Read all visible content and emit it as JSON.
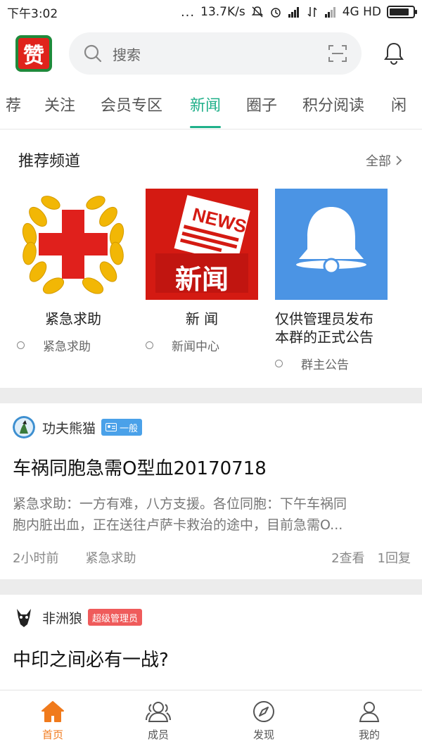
{
  "status_bar": {
    "time": "下午3:02",
    "dots": "...",
    "net_speed": "13.7K/s",
    "network": "4G HD"
  },
  "header": {
    "logo_char": "赞",
    "search_placeholder": "搜索"
  },
  "tabs": [
    {
      "label": "荐"
    },
    {
      "label": "关注"
    },
    {
      "label": "会员专区"
    },
    {
      "label": "新闻",
      "active": true
    },
    {
      "label": "圈子"
    },
    {
      "label": "积分阅读"
    },
    {
      "label": "闲"
    }
  ],
  "channels": {
    "title": "推荐频道",
    "all_label": "全部",
    "items": [
      {
        "name": "紧急求助",
        "sub": "紧急求助"
      },
      {
        "name": "新 闻",
        "sub": "新闻中心",
        "thumb_text_top": "NEWS",
        "thumb_text_bottom": "新闻"
      },
      {
        "name_line1": "仅供管理员发布",
        "name_line2": "本群的正式公告",
        "sub": "群主公告"
      }
    ]
  },
  "posts": [
    {
      "author": "功夫熊猫",
      "badge": "一般",
      "title": "车祸同胞急需O型血20170718",
      "excerpt_line1": "紧急求助：一方有难，八方支援。各位同胞：下午车祸同",
      "excerpt_line2": "胞内脏出血，正在送往卢萨卡救治的途中，目前急需O...",
      "time": "2小时前",
      "category": "紧急求助",
      "views": "2查看",
      "replies": "1回复"
    },
    {
      "author": "非洲狼",
      "badge": "超级管理员",
      "title": "中印之间必有一战?"
    }
  ],
  "bottom_nav": [
    {
      "label": "首页",
      "icon": "home-icon",
      "active": true
    },
    {
      "label": "成员",
      "icon": "members-icon"
    },
    {
      "label": "发现",
      "icon": "compass-icon"
    },
    {
      "label": "我的",
      "icon": "profile-icon"
    }
  ],
  "colors": {
    "accent_green": "#20b08a",
    "nav_active": "#f07a1c",
    "badge_blue": "#4aa1e9",
    "badge_red": "#ef5b5b"
  }
}
